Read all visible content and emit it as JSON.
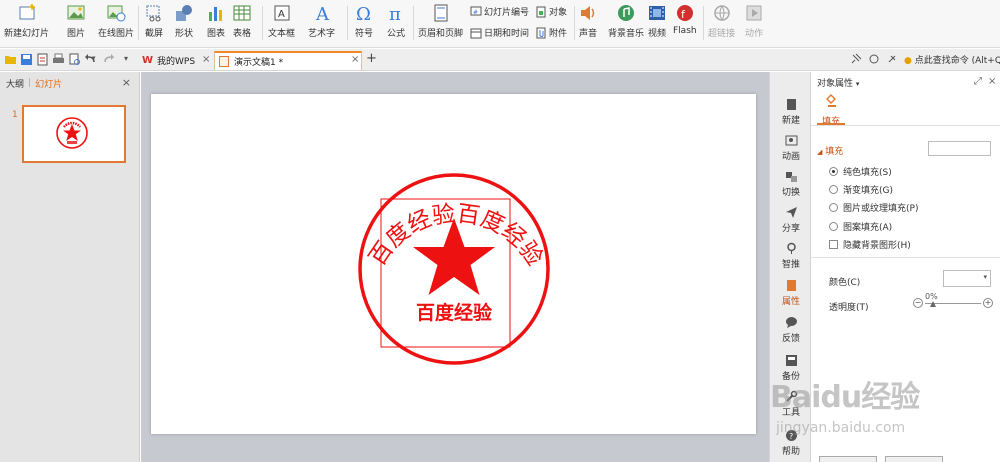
{
  "ribbon": {
    "new_slide": "新建幻灯片",
    "picture": "图片",
    "online_picture": "在线图片",
    "screenshot": "截屏",
    "shape": "形状",
    "chart": "图表",
    "table": "表格",
    "textbox": "文本框",
    "wordart": "艺术字",
    "symbol": "符号",
    "formula": "公式",
    "header_footer": "页眉和页脚",
    "slide_number": "幻灯片编号",
    "object": "对象",
    "date_time": "日期和时间",
    "attachment": "附件",
    "audio": "声音",
    "bg_music": "背景音乐",
    "video": "视频",
    "flash": "Flash",
    "hyperlink": "超链接",
    "action": "动作"
  },
  "tabs": {
    "my_wps": "我的WPS",
    "doc": "演示文稿1 *",
    "find_command": "点此查找命令 (Alt+Q"
  },
  "left_panel": {
    "outline_tab": "大纲",
    "slides_tab": "幻灯片",
    "slide_number": "1"
  },
  "stamp": {
    "arc_text": "百度经验百度经验",
    "bottom_text": "百度经验",
    "color": "#ee1111"
  },
  "vstrip": {
    "new": "新建",
    "animation": "动画",
    "transition": "切换",
    "share": "分享",
    "smart": "智推",
    "properties": "属性",
    "feedback": "反馈",
    "backup": "备份",
    "tools": "工具",
    "help": "帮助"
  },
  "props": {
    "title": "对象属性",
    "fill_tab": "填充",
    "fill_section": "填充",
    "solid": "纯色填充(S)",
    "gradient": "渐变填充(G)",
    "picture_texture": "图片或纹理填充(P)",
    "pattern": "图案填充(A)",
    "hide_bg": "隐藏背景图形(H)",
    "color_label": "颜色(C)",
    "transparency_label": "透明度(T)",
    "transparency_value": "0%"
  },
  "watermark": {
    "brand": "Baidu经验",
    "url": "jingyan.baidu.com"
  },
  "colors": {
    "accent": "#e07a30",
    "stamp_red": "#ee1111",
    "canvas_bg": "#c7c9d0"
  }
}
